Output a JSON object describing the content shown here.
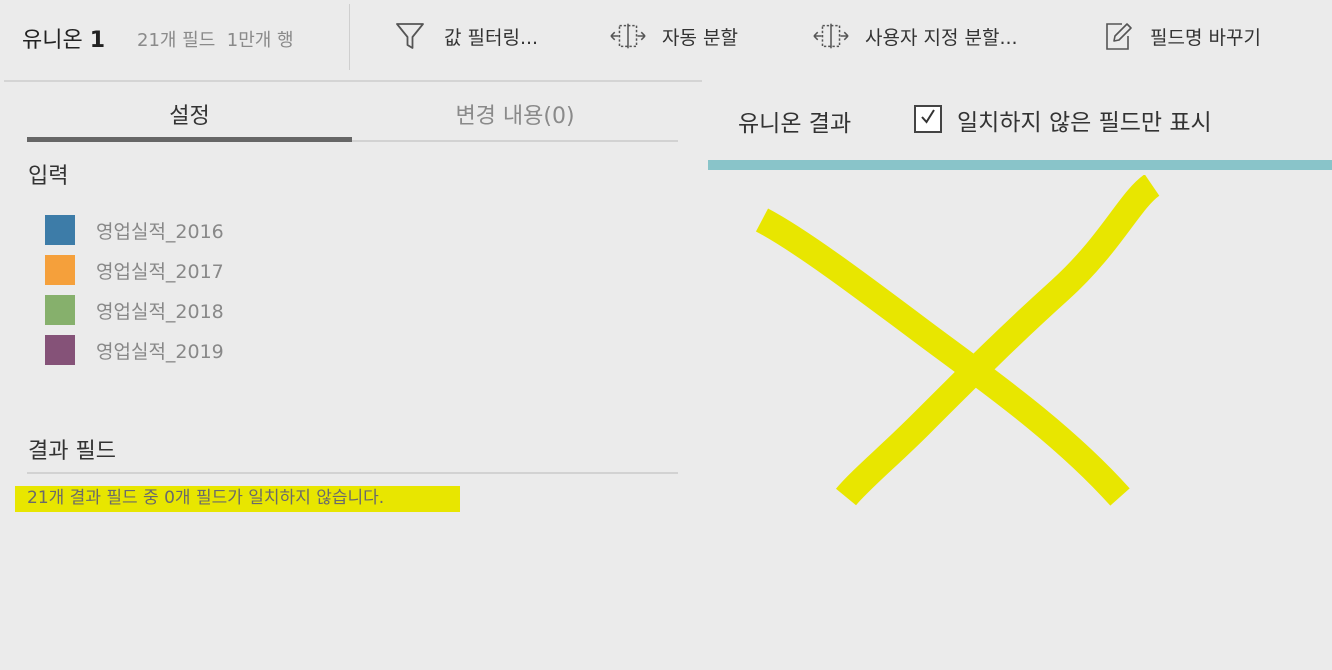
{
  "toolbar": {
    "union_name": "유니온",
    "union_number": "1",
    "field_count": "21개 필드",
    "row_count": "1만개 행",
    "filter_label": "값 필터링...",
    "auto_split_label": "자동 분할",
    "custom_split_label": "사용자 지정 분할...",
    "rename_label": "필드명 바꾸기"
  },
  "tabs": {
    "settings": "설정",
    "changes": "변경 내용(0)",
    "active": "settings"
  },
  "inputs": {
    "heading": "입력",
    "items": [
      {
        "name": "영업실적_2016",
        "color": "#3d7ca8"
      },
      {
        "name": "영업실적_2017",
        "color": "#f5a03b"
      },
      {
        "name": "영업실적_2018",
        "color": "#86b06c"
      },
      {
        "name": "영업실적_2019",
        "color": "#855278"
      }
    ]
  },
  "result_fields": {
    "heading": "결과 필드",
    "message": "21개 결과 필드 중 0개 필드가 일치하지 않습니다.",
    "highlight_color": "#e8e600"
  },
  "union_result": {
    "title": "유니온 결과",
    "checkbox_label": "일치하지 않은 필드만 표시",
    "checkbox_checked": true,
    "accent_color": "#89c4c9",
    "annotation_color": "#e8e600",
    "annotation_icon": "x-mark-annotation"
  }
}
